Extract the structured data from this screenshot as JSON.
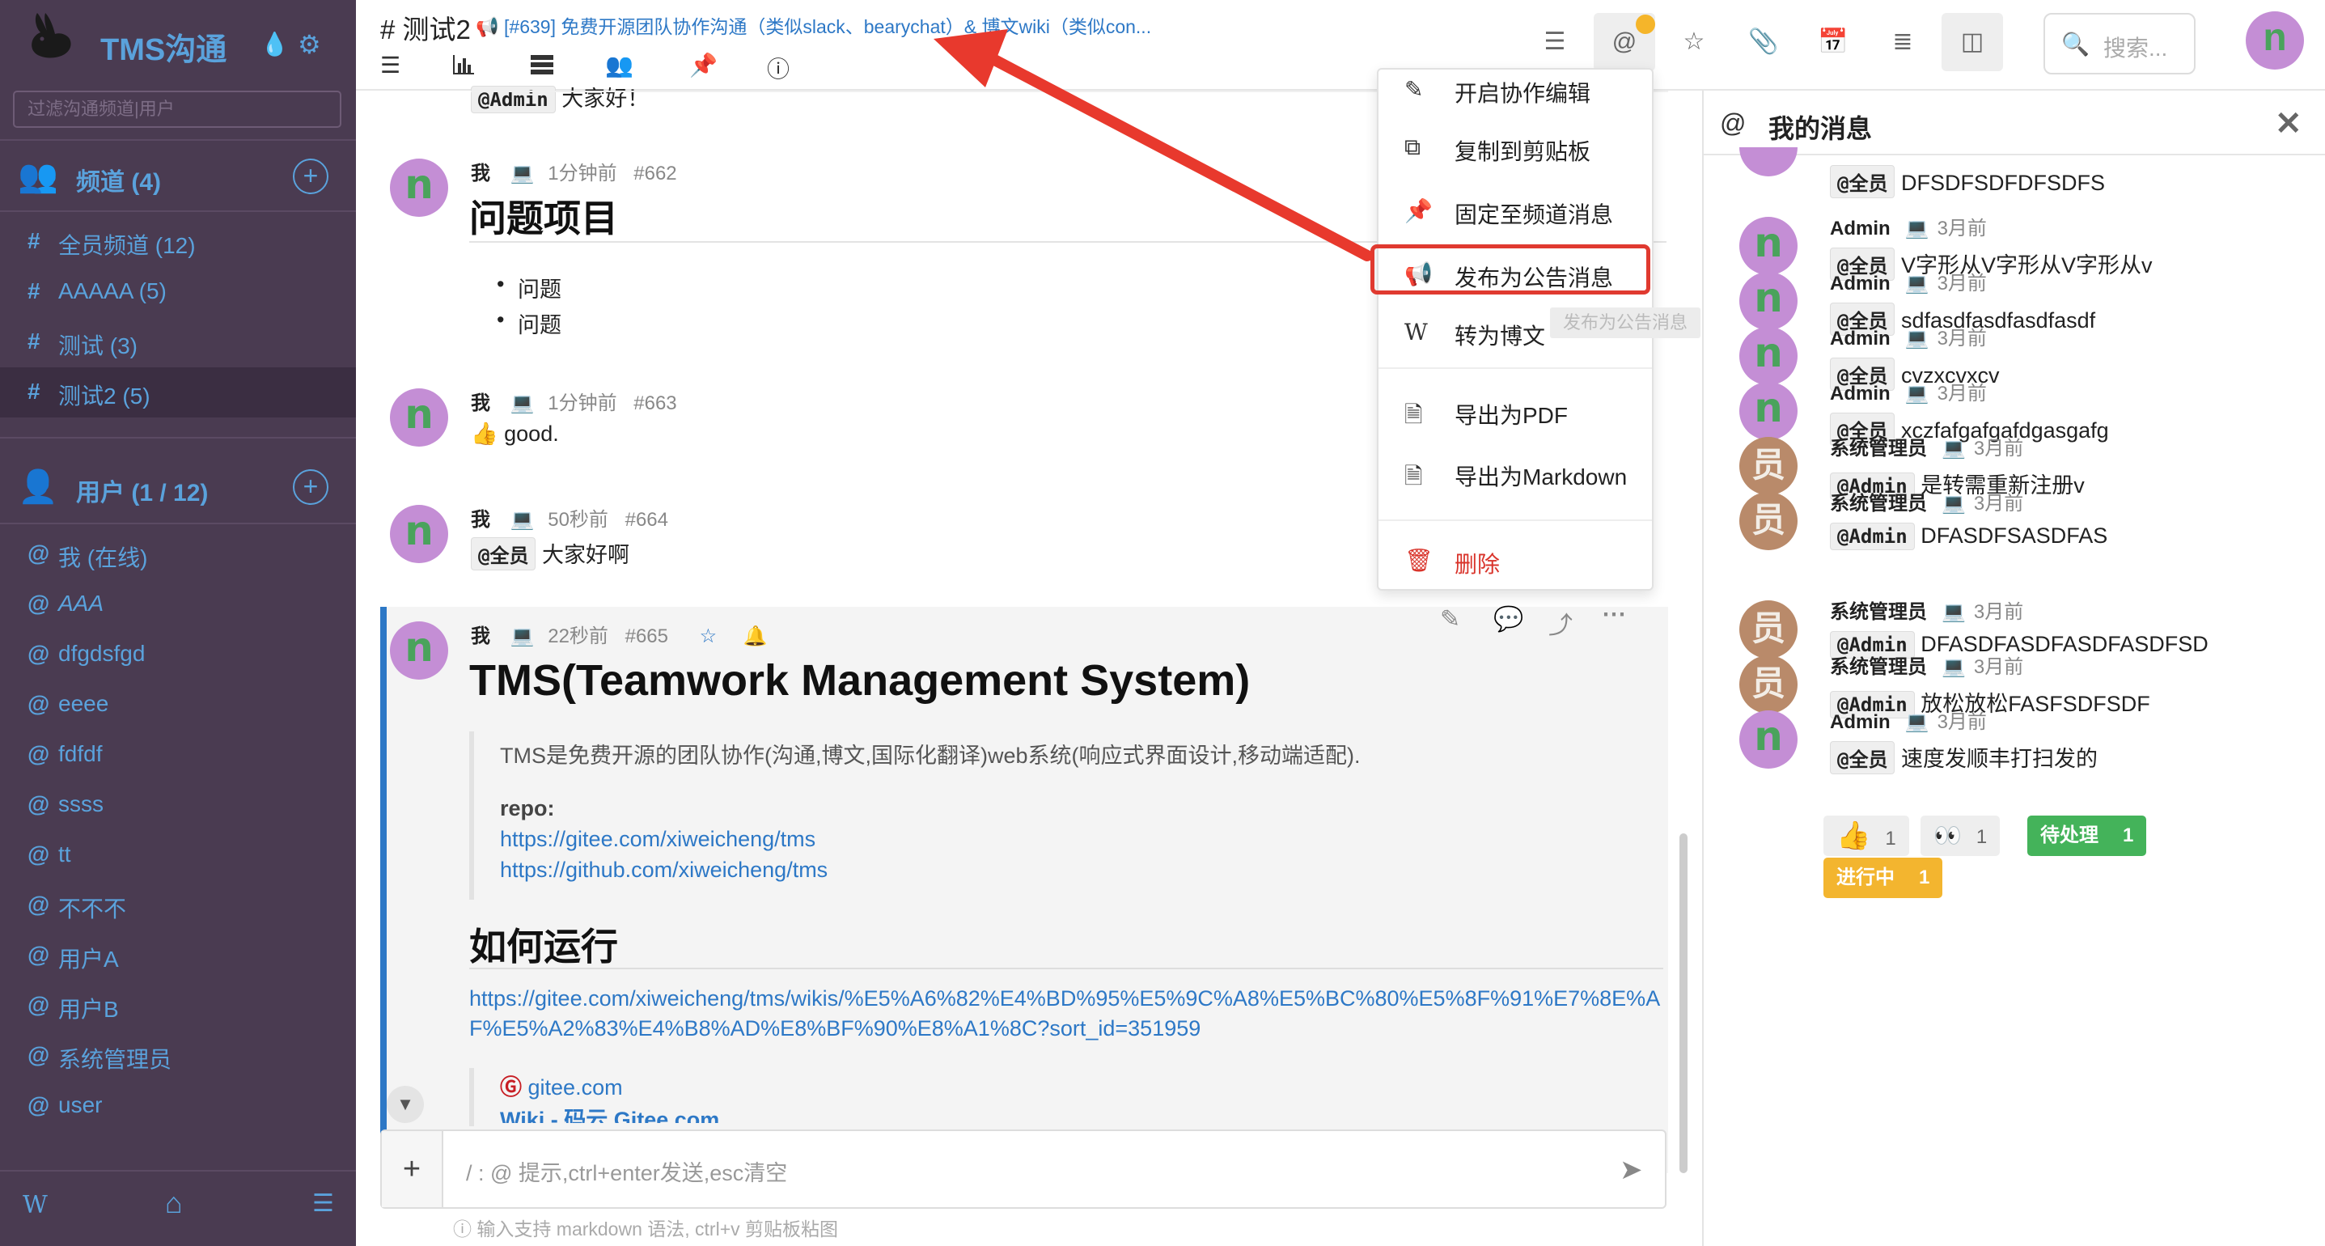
{
  "app": {
    "title": "TMS沟通",
    "filter_placeholder": "过滤沟通频道|用户"
  },
  "sidebar": {
    "channels_label": "频道 (4)",
    "channels": [
      {
        "prefix": "#",
        "label": "全员频道 (12)"
      },
      {
        "prefix": "#",
        "label": "AAAAA (5)"
      },
      {
        "prefix": "#",
        "label": "测试 (3)"
      },
      {
        "prefix": "#",
        "label": "测试2 (5)",
        "active": true
      }
    ],
    "users_label": "用户 (1 / 12)",
    "users": [
      {
        "prefix": "@",
        "label": "我 (在线)"
      },
      {
        "prefix": "@",
        "label": "AAA"
      },
      {
        "prefix": "@",
        "label": "dfgdsfgd"
      },
      {
        "prefix": "@",
        "label": "eeee"
      },
      {
        "prefix": "@",
        "label": "fdfdf"
      },
      {
        "prefix": "@",
        "label": "ssss"
      },
      {
        "prefix": "@",
        "label": "tt"
      },
      {
        "prefix": "@",
        "label": "不不不"
      },
      {
        "prefix": "@",
        "label": "用户A"
      },
      {
        "prefix": "@",
        "label": "用户B"
      },
      {
        "prefix": "@",
        "label": "系统管理员"
      },
      {
        "prefix": "@",
        "label": "user"
      }
    ],
    "bottom": {
      "wiki": "W",
      "home": "home-icon",
      "menu": "menu-icon"
    }
  },
  "header": {
    "channel_title": "# 测试2",
    "notice": "[#639] 免费开源团队协作沟通（类似slack、bearychat）& 博文wiki（类似con...",
    "search_placeholder": "搜索...",
    "avatar_letter": "n",
    "toolbar_icons": [
      "menu-icon",
      "bar-chart-icon",
      "server-icon",
      "users-icon",
      "pin-icon",
      "info-icon"
    ],
    "right_icons": [
      "list-icon",
      "at-icon",
      "star-icon",
      "paperclip-icon",
      "calendar-icon",
      "list-alt-icon",
      "columns-icon"
    ]
  },
  "messages": {
    "prev_tail": {
      "tag": "@Admin",
      "text": "大家好！"
    },
    "m662": {
      "author": "我",
      "time": "1分钟前",
      "num": "#662",
      "heading": "问题项目",
      "bullets": [
        "问题",
        "问题"
      ]
    },
    "m663": {
      "author": "我",
      "time": "1分钟前",
      "num": "#663",
      "emoji": "👍",
      "text": "good."
    },
    "m664": {
      "author": "我",
      "time": "50秒前",
      "num": "#664",
      "tag": "@全员",
      "text": "大家好啊"
    },
    "m665": {
      "author": "我",
      "time": "22秒前",
      "num": "#665",
      "heading": "TMS(Teamwork Management System)",
      "intro": "TMS是免费开源的团队协作(沟通,博文,国际化翻译)web系统(响应式界面设计,移动端适配).",
      "repo_label": "repo:",
      "repo_links": [
        "https://gitee.com/xiweicheng/tms",
        "https://github.com/xiweicheng/tms"
      ],
      "heading2": "如何运行",
      "run_link": "https://gitee.com/xiweicheng/tms/wikis/%E5%A6%82%E4%BD%95%E5%9C%A8%E5%BC%80%E5%8F%91%E7%8E%AF%E5%A2%83%E4%B8%AD%E8%BF%90%E8%A1%8C?sort_id=351959",
      "card_site": "gitee.com",
      "card_title": "Wiki - 码云 Gitee.com"
    }
  },
  "composer": {
    "placeholder": "/ : @ 提示,ctrl+enter发送,esc清空",
    "hint": "输入支持 markdown 语法, ctrl+v 剪贴板粘图"
  },
  "context_menu": {
    "items": [
      {
        "icon": "✎",
        "label": "开启协作编辑"
      },
      {
        "icon": "⧉",
        "label": "复制到剪贴板"
      },
      {
        "icon": "📌",
        "label": "固定至频道消息"
      },
      {
        "icon": "📢",
        "label": "发布为公告消息",
        "highlighted": true
      },
      {
        "icon": "W",
        "label": "转为博文"
      },
      {
        "icon": "🗎",
        "label": "导出为PDF"
      },
      {
        "icon": "🗎",
        "label": "导出为Markdown"
      },
      {
        "icon": "🗑",
        "label": "删除",
        "danger": true
      }
    ],
    "tooltip": "发布为公告消息"
  },
  "right_panel": {
    "title": "我的消息",
    "items": [
      {
        "tag": "@全员",
        "text": "DFSDFSDFDFSDFS",
        "partial": true
      },
      {
        "author": "Admin",
        "time": "3月前",
        "tag": "@全员",
        "text": "V字形从V字形从V字形从v",
        "avatar": "n"
      },
      {
        "author": "Admin",
        "time": "3月前",
        "tag": "@全员",
        "text": "sdfasdfasdfasdfasdf",
        "avatar": "n"
      },
      {
        "author": "Admin",
        "time": "3月前",
        "tag": "@全员",
        "text": "cvzxcvxcv",
        "avatar": "n"
      },
      {
        "author": "Admin",
        "time": "3月前",
        "tag": "@全员",
        "text": "xczfafgafgafdgasgafg",
        "avatar": "n"
      },
      {
        "author": "系统管理员",
        "time": "3月前",
        "tag": "@Admin",
        "text": "是转需重新注册v",
        "avatar": "员"
      },
      {
        "author": "系统管理员",
        "time": "3月前",
        "tag": "@Admin",
        "text": "DFASDFSASDFAS",
        "avatar": "员"
      },
      {
        "author": "系统管理员",
        "time": "3月前",
        "tag": "@Admin",
        "text": "DFASDFASDFASDFASDFSD",
        "avatar": "员"
      },
      {
        "author": "系统管理员",
        "time": "3月前",
        "tag": "@Admin",
        "text": "放松放松FASFSDFSDF",
        "avatar": "员"
      },
      {
        "author": "Admin",
        "time": "3月前",
        "tag": "@全员",
        "text": "速度发顺丰打扫发的",
        "avatar": "n"
      }
    ],
    "reactions": [
      {
        "label": "👍",
        "count": "1"
      },
      {
        "label": "👀",
        "count": "1"
      },
      {
        "label": "待处理",
        "count": "1"
      },
      {
        "label": "进行中",
        "count": "1"
      }
    ]
  },
  "colors": {
    "sidebar_bg": "#4a3b51",
    "accent": "#5aa2dc",
    "link": "#2d78c6",
    "highlight_border": "#e03a30",
    "arrow": "#e8392d",
    "green_badge": "#44b35a",
    "yellow_badge": "#f3b52f"
  }
}
